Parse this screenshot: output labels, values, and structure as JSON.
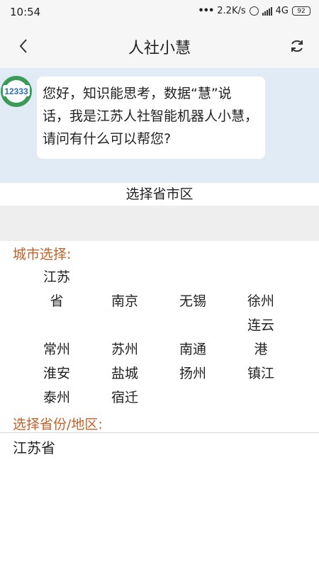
{
  "status_bar": {
    "time": "10:54",
    "network_speed": "2.2K/s",
    "network_type": "4G",
    "battery": "92"
  },
  "header": {
    "title": "人社小慧",
    "back_icon": "chevron-left-icon",
    "refresh_icon": "refresh-icon"
  },
  "chat": {
    "avatar_text": "12333",
    "message": "您好，知识能思考，数据“慧”说话，我是江苏人社智能机器人小慧，请问有什么可以帮您?"
  },
  "region": {
    "title": "选择省市区",
    "city_label": "城市选择:",
    "cities": {
      "jiangsu": "江苏省",
      "nanjing": "南京",
      "wuxi": "无锡",
      "xuzhou": "徐州",
      "changzhou": "常州",
      "suzhou": "苏州",
      "nantong": "南通",
      "lianyungang": "连云港",
      "huaian": "淮安",
      "yancheng": "盐城",
      "yangzhou": "扬州",
      "zhenjiang": "镇江",
      "taizhou": "泰州",
      "suqian": "宿迁"
    },
    "province_label": "选择省份/地区:",
    "province_value": "江苏省"
  },
  "colors": {
    "accent_orange": "#c0622a",
    "chat_background": "#e1ebf6"
  }
}
